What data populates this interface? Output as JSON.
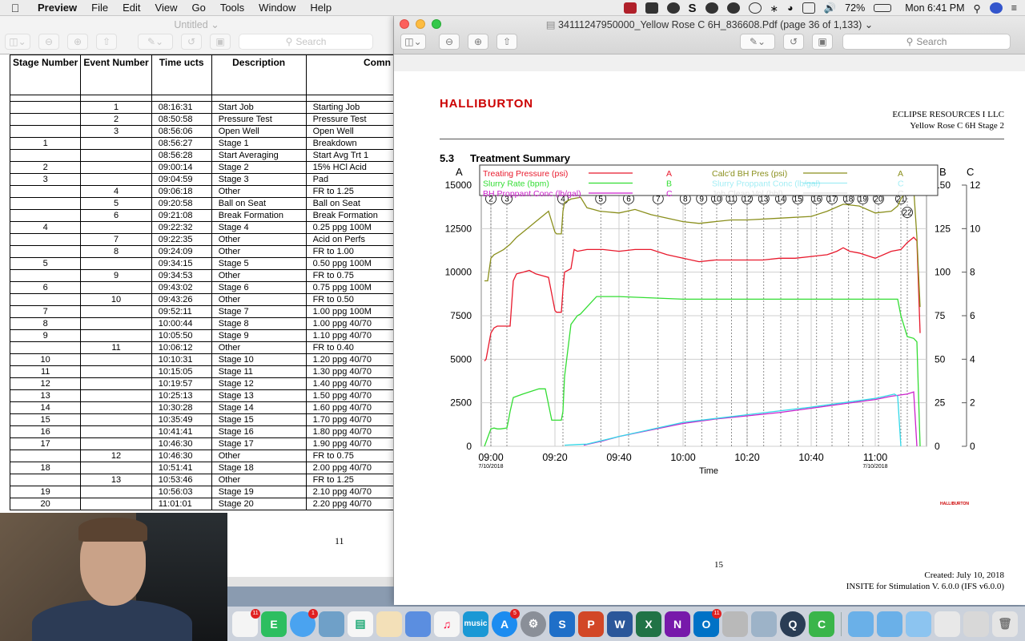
{
  "menubar": {
    "app": "Preview",
    "items": [
      "File",
      "Edit",
      "View",
      "Go",
      "Tools",
      "Window",
      "Help"
    ],
    "battery": "72%",
    "clock": "Mon 6:41 PM"
  },
  "left_window": {
    "title": "Untitled",
    "search_placeholder": "Search",
    "headers": [
      "Stage Number",
      "Event Number",
      "Time ucts",
      "Description",
      "Comn"
    ],
    "rows": [
      {
        "stage": "",
        "event": "1",
        "time": "08:16:31",
        "desc": "Start Job",
        "comment": "Starting Job"
      },
      {
        "stage": "",
        "event": "2",
        "time": "08:50:58",
        "desc": "Pressure Test",
        "comment": "Pressure Test"
      },
      {
        "stage": "",
        "event": "3",
        "time": "08:56:06",
        "desc": "Open Well",
        "comment": "Open Well"
      },
      {
        "stage": "1",
        "event": "",
        "time": "08:56:27",
        "desc": "Stage 1",
        "comment": "Breakdown"
      },
      {
        "stage": "",
        "event": "",
        "time": "08:56:28",
        "desc": "Start Averaging",
        "comment": "Start Avg Trt 1"
      },
      {
        "stage": "2",
        "event": "",
        "time": "09:00:14",
        "desc": "Stage 2",
        "comment": "15% HCl Acid"
      },
      {
        "stage": "3",
        "event": "",
        "time": "09:04:59",
        "desc": "Stage 3",
        "comment": "Pad"
      },
      {
        "stage": "",
        "event": "4",
        "time": "09:06:18",
        "desc": "Other",
        "comment": "FR to 1.25"
      },
      {
        "stage": "",
        "event": "5",
        "time": "09:20:58",
        "desc": "Ball on Seat",
        "comment": "Ball on Seat"
      },
      {
        "stage": "",
        "event": "6",
        "time": "09:21:08",
        "desc": "Break Formation",
        "comment": "Break Formation"
      },
      {
        "stage": "4",
        "event": "",
        "time": "09:22:32",
        "desc": "Stage 4",
        "comment": "0.25 ppg 100M"
      },
      {
        "stage": "",
        "event": "7",
        "time": "09:22:35",
        "desc": "Other",
        "comment": "Acid on Perfs"
      },
      {
        "stage": "",
        "event": "8",
        "time": "09:24:09",
        "desc": "Other",
        "comment": "FR to 1.00"
      },
      {
        "stage": "5",
        "event": "",
        "time": "09:34:15",
        "desc": "Stage 5",
        "comment": "0.50 ppg 100M"
      },
      {
        "stage": "",
        "event": "9",
        "time": "09:34:53",
        "desc": "Other",
        "comment": "FR to 0.75"
      },
      {
        "stage": "6",
        "event": "",
        "time": "09:43:02",
        "desc": "Stage 6",
        "comment": "0.75 ppg 100M"
      },
      {
        "stage": "",
        "event": "10",
        "time": "09:43:26",
        "desc": "Other",
        "comment": "FR to 0.50"
      },
      {
        "stage": "7",
        "event": "",
        "time": "09:52:11",
        "desc": "Stage 7",
        "comment": "1.00 ppg 100M"
      },
      {
        "stage": "8",
        "event": "",
        "time": "10:00:44",
        "desc": "Stage 8",
        "comment": "1.00 ppg 40/70"
      },
      {
        "stage": "9",
        "event": "",
        "time": "10:05:50",
        "desc": "Stage 9",
        "comment": "1.10 ppg 40/70"
      },
      {
        "stage": "",
        "event": "11",
        "time": "10:06:12",
        "desc": "Other",
        "comment": "FR to 0.40"
      },
      {
        "stage": "10",
        "event": "",
        "time": "10:10:31",
        "desc": "Stage 10",
        "comment": "1.20 ppg 40/70"
      },
      {
        "stage": "11",
        "event": "",
        "time": "10:15:05",
        "desc": "Stage 11",
        "comment": "1.30 ppg 40/70"
      },
      {
        "stage": "12",
        "event": "",
        "time": "10:19:57",
        "desc": "Stage 12",
        "comment": "1.40 ppg 40/70"
      },
      {
        "stage": "13",
        "event": "",
        "time": "10:25:13",
        "desc": "Stage 13",
        "comment": "1.50 ppg 40/70"
      },
      {
        "stage": "14",
        "event": "",
        "time": "10:30:28",
        "desc": "Stage 14",
        "comment": "1.60 ppg 40/70"
      },
      {
        "stage": "15",
        "event": "",
        "time": "10:35:49",
        "desc": "Stage 15",
        "comment": "1.70 ppg 40/70"
      },
      {
        "stage": "16",
        "event": "",
        "time": "10:41:41",
        "desc": "Stage 16",
        "comment": "1.80 ppg 40/70"
      },
      {
        "stage": "17",
        "event": "",
        "time": "10:46:30",
        "desc": "Stage 17",
        "comment": "1.90 ppg 40/70"
      },
      {
        "stage": "",
        "event": "12",
        "time": "10:46:30",
        "desc": "Other",
        "comment": "FR to 0.75"
      },
      {
        "stage": "18",
        "event": "",
        "time": "10:51:41",
        "desc": "Stage 18",
        "comment": "2.00 ppg 40/70"
      },
      {
        "stage": "",
        "event": "13",
        "time": "10:53:46",
        "desc": "Other",
        "comment": "FR to 1.25"
      },
      {
        "stage": "19",
        "event": "",
        "time": "10:56:03",
        "desc": "Stage 19",
        "comment": "2.10 ppg 40/70"
      },
      {
        "stage": "20",
        "event": "",
        "time": "11:01:01",
        "desc": "Stage 20",
        "comment": "2.20 ppg 40/70"
      }
    ],
    "page_number": "11"
  },
  "right_window": {
    "title": "34111247950000_Yellow Rose C 6H_836608.Pdf (page 36 of 1,133)",
    "search_placeholder": "Search",
    "logo": "HALLIBURTON",
    "company": "ECLIPSE RESOURCES I LLC",
    "well": "Yellow Rose C 6H Stage 2",
    "section_number": "5.3",
    "section_title": "Treatment Summary",
    "page_number": "15",
    "created": "Created: July 10, 2018",
    "software": "INSITE for Stimulation V. 6.0.0 (IFS v6.0.0)",
    "mini_logo": "HALLIBURTON"
  },
  "chart_data": {
    "type": "line",
    "xlabel": "Time",
    "x_ticks": [
      "09:00",
      "09:20",
      "09:40",
      "10:00",
      "10:20",
      "10:40",
      "11:00"
    ],
    "x_dates": [
      "7/10/2018",
      "7/10/2018"
    ],
    "x_range_minutes": [
      0,
      137
    ],
    "axes": {
      "A": {
        "label": "A",
        "range": [
          0,
          15000
        ],
        "ticks": [
          0,
          2500,
          5000,
          7500,
          10000,
          12500,
          15000
        ]
      },
      "B": {
        "label": "B",
        "range": [
          0,
          150
        ],
        "ticks": [
          0,
          25,
          50,
          75,
          100,
          125,
          150
        ]
      },
      "C": {
        "label": "C",
        "range": [
          0,
          12
        ],
        "ticks": [
          0,
          2,
          4,
          6,
          8,
          10,
          12
        ]
      }
    },
    "stage_markers": [
      {
        "label": "2",
        "t": 0
      },
      {
        "label": "3",
        "t": 5
      },
      {
        "label": "4",
        "t": 22.5
      },
      {
        "label": "5",
        "t": 34.3
      },
      {
        "label": "6",
        "t": 43
      },
      {
        "label": "7",
        "t": 52.2
      },
      {
        "label": "8",
        "t": 60.7
      },
      {
        "label": "9",
        "t": 65.8
      },
      {
        "label": "10",
        "t": 70.5
      },
      {
        "label": "11",
        "t": 75.1
      },
      {
        "label": "12",
        "t": 80
      },
      {
        "label": "13",
        "t": 85.2
      },
      {
        "label": "14",
        "t": 90.5
      },
      {
        "label": "15",
        "t": 95.8
      },
      {
        "label": "16",
        "t": 101.7
      },
      {
        "label": "17",
        "t": 106.5
      },
      {
        "label": "18",
        "t": 111.7
      },
      {
        "label": "19",
        "t": 116.1
      },
      {
        "label": "20",
        "t": 121
      },
      {
        "label": "21",
        "t": 128
      },
      {
        "label": "22",
        "t": 130
      }
    ],
    "series": [
      {
        "name": "Treating Pressure (psi)",
        "axis": "A",
        "color": "#e8192c",
        "t": [
          -2,
          -1.5,
          0,
          1,
          2,
          4,
          6,
          7,
          8,
          10,
          12,
          14,
          16,
          18,
          20,
          20.5,
          22,
          22.5,
          23,
          25,
          26,
          27,
          30,
          35,
          40,
          45,
          50,
          55,
          60,
          65,
          70,
          75,
          80,
          85,
          90,
          95,
          100,
          105,
          108,
          110,
          112,
          115,
          120,
          125,
          128,
          130,
          132,
          133,
          134
        ],
        "y": [
          4900,
          5000,
          6500,
          6800,
          6900,
          6900,
          6900,
          9500,
          9900,
          10000,
          10100,
          9900,
          9800,
          9700,
          7800,
          7700,
          7700,
          9000,
          10000,
          10200,
          11300,
          11200,
          11300,
          11300,
          11200,
          11300,
          11300,
          11000,
          10800,
          10600,
          10700,
          10700,
          10700,
          10700,
          10800,
          10800,
          10900,
          11000,
          11200,
          11400,
          11200,
          11100,
          10800,
          11200,
          11300,
          11700,
          12000,
          11800,
          6500
        ]
      },
      {
        "name": "Slurry Rate (bpm)",
        "axis": "B",
        "color": "#33dd33",
        "t": [
          -2,
          0,
          1,
          2,
          3,
          5,
          5.5,
          6,
          7,
          10,
          15,
          17,
          19,
          20,
          22,
          22.5,
          23,
          25,
          27,
          28,
          30,
          33,
          40,
          60,
          80,
          100,
          120,
          127,
          128,
          130,
          132,
          133,
          134
        ],
        "y": [
          0,
          10,
          10.5,
          10,
          10,
          10.5,
          15,
          20,
          28,
          30,
          33,
          33,
          15,
          15,
          15,
          20,
          40,
          70,
          75,
          76,
          80,
          86,
          86,
          84.5,
          84.5,
          84.5,
          84.5,
          84.5,
          75,
          63,
          62,
          60,
          0
        ]
      },
      {
        "name": "BH Proppant Conc (lb/gal)",
        "axis": "C",
        "color": "#cc22cc",
        "t": [
          29,
          35,
          40,
          50,
          60,
          70,
          80,
          90,
          100,
          110,
          120,
          125,
          130,
          132,
          133
        ],
        "y": [
          0.05,
          0.25,
          0.45,
          0.75,
          1.05,
          1.25,
          1.4,
          1.55,
          1.75,
          1.95,
          2.15,
          2.3,
          2.4,
          2.5,
          0
        ]
      },
      {
        "name": "Calc'd BH Pres (psi)",
        "axis": "A",
        "color": "#8a8f1c",
        "t": [
          -2,
          -1,
          0,
          1,
          2,
          4,
          6,
          8,
          10,
          12,
          14,
          16,
          18,
          20,
          20.5,
          22,
          22.5,
          23,
          25,
          28,
          30,
          32,
          34,
          40,
          45,
          50,
          55,
          60,
          65,
          70,
          75,
          80,
          90,
          100,
          105,
          110,
          115,
          120,
          125,
          127,
          128,
          130,
          131,
          132,
          133,
          134
        ],
        "y": [
          9500,
          9500,
          10800,
          11000,
          11100,
          11300,
          11600,
          12000,
          12300,
          12600,
          12900,
          13200,
          13500,
          12300,
          12200,
          12200,
          13500,
          14000,
          14200,
          14300,
          13700,
          13600,
          13500,
          13400,
          13600,
          13300,
          13100,
          12900,
          12800,
          12900,
          13000,
          13000,
          13100,
          13200,
          13500,
          13900,
          13800,
          13400,
          13500,
          13800,
          14200,
          14800,
          14900,
          14800,
          12000,
          8000
        ]
      },
      {
        "name": "Slurry Proppant Conc (lb/gal)",
        "axis": "C",
        "color": "#33d8e8",
        "t": [
          23,
          27,
          30,
          40,
          60,
          80,
          100,
          120,
          126,
          127,
          128
        ],
        "y": [
          0.05,
          0.08,
          0.1,
          0.45,
          1.1,
          1.45,
          1.8,
          2.2,
          2.4,
          2.3,
          0
        ]
      },
      {
        "name": "Job Clean Vol (bbl)",
        "axis": "C",
        "color": "#bbbbbb",
        "t": [],
        "y": []
      }
    ],
    "legend_letters": [
      "A",
      "B",
      "C",
      "A",
      "C",
      "C"
    ]
  },
  "dock": {
    "badges": {
      "calendar": "11",
      "messages": "1",
      "appstore": "5",
      "outlook": "11"
    }
  }
}
